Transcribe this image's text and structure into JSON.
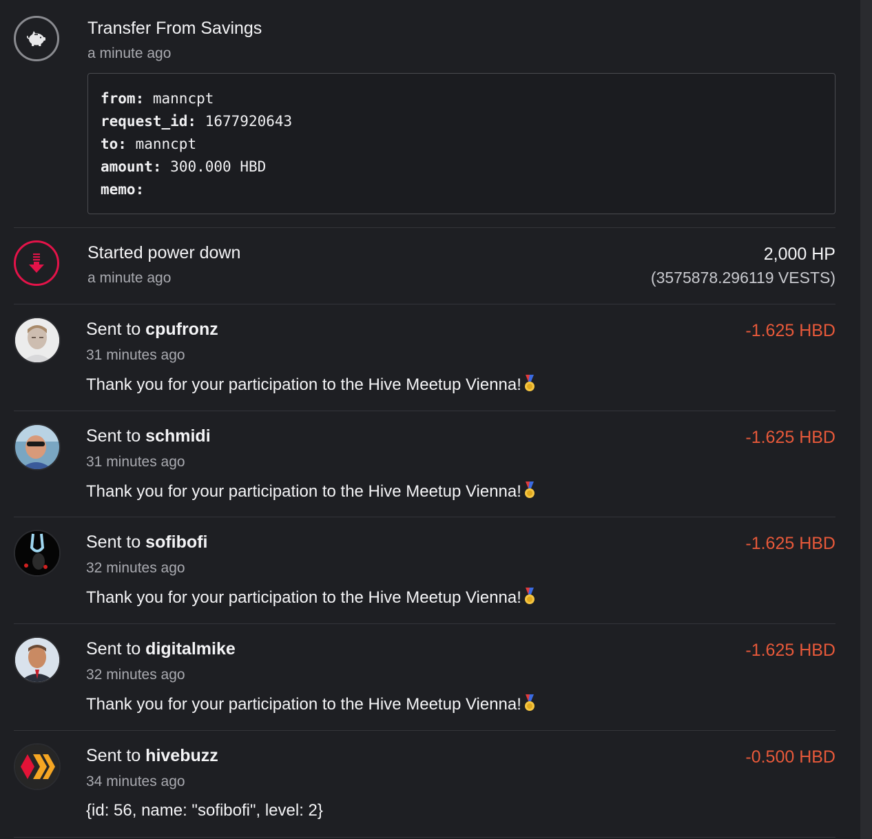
{
  "feed": {
    "savings": {
      "icon": "piggy-bank-icon",
      "title": "Transfer From Savings",
      "time": "a minute ago",
      "fields": [
        {
          "key": "from:",
          "value": "manncpt"
        },
        {
          "key": "request_id:",
          "value": "1677920643"
        },
        {
          "key": "to:",
          "value": "manncpt"
        },
        {
          "key": "amount:",
          "value": "300.000 HBD"
        },
        {
          "key": "memo:",
          "value": ""
        }
      ]
    },
    "powerdown": {
      "icon": "power-down-arrow-icon",
      "title": "Started power down",
      "time": "a minute ago",
      "amount": "2,000 HP",
      "vests": "(3575878.296119 VESTS)"
    },
    "transfers": [
      {
        "prefix": "Sent to ",
        "user": "cpufronz",
        "time": "31 minutes ago",
        "memo": "Thank you for your participation to the Hive Meetup Vienna!",
        "amount": "-1.625 HBD"
      },
      {
        "prefix": "Sent to ",
        "user": "schmidi",
        "time": "31 minutes ago",
        "memo": "Thank you for your participation to the Hive Meetup Vienna!",
        "amount": "-1.625 HBD"
      },
      {
        "prefix": "Sent to ",
        "user": "sofibofi",
        "time": "32 minutes ago",
        "memo": "Thank you for your participation to the Hive Meetup Vienna!",
        "amount": "-1.625 HBD"
      },
      {
        "prefix": "Sent to ",
        "user": "digitalmike",
        "time": "32 minutes ago",
        "memo": "Thank you for your participation to the Hive Meetup Vienna!",
        "amount": "-1.625 HBD"
      },
      {
        "prefix": "Sent to ",
        "user": "hivebuzz",
        "time": "34 minutes ago",
        "memo": "{id: 56, name: \"sofibofi\", level: 2}",
        "amount": "-0.500 HBD"
      }
    ]
  },
  "colors": {
    "background": "#1e1f23",
    "negative_amount": "#e8593a",
    "power_down": "#e31349"
  }
}
